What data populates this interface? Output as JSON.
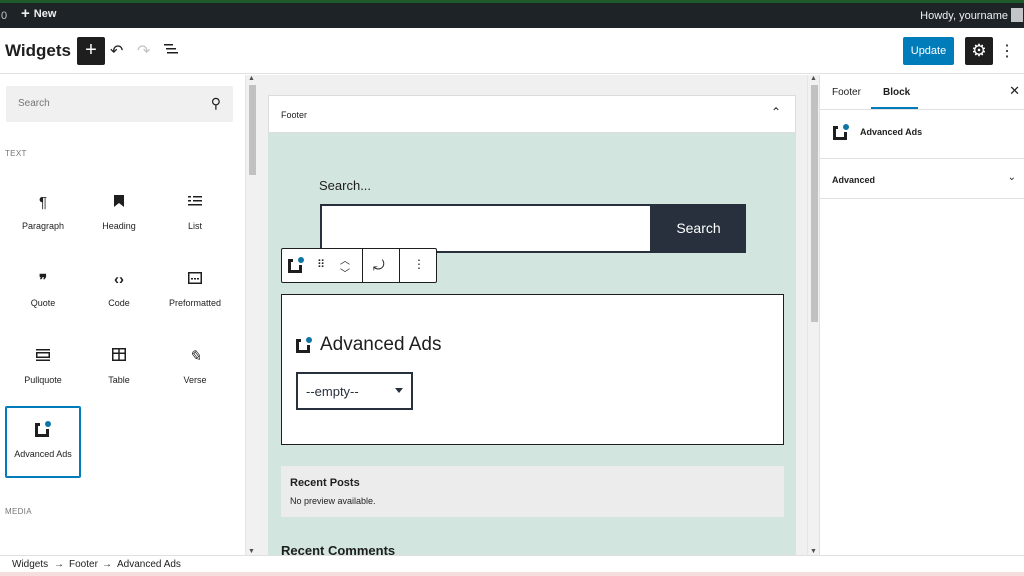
{
  "admin_bar": {
    "count": "0",
    "new_label": "New",
    "howdy": "Howdy, yourname"
  },
  "header": {
    "title": "Widgets",
    "update_label": "Update",
    "icons": [
      "plus-icon",
      "undo-icon",
      "redo-icon",
      "list-view-icon",
      "gear-icon",
      "more-options-icon"
    ]
  },
  "inserter": {
    "search_placeholder": "Search",
    "category_text": "TEXT",
    "category_media": "MEDIA",
    "blocks": [
      {
        "label": "Paragraph",
        "icon": "paragraph-icon",
        "glyph": "¶"
      },
      {
        "label": "Heading",
        "icon": "heading-icon",
        "glyph": "🔖"
      },
      {
        "label": "List",
        "icon": "list-icon",
        "glyph": "☰"
      },
      {
        "label": "Quote",
        "icon": "quote-icon",
        "glyph": "❞"
      },
      {
        "label": "Code",
        "icon": "code-icon",
        "glyph": "‹›"
      },
      {
        "label": "Preformatted",
        "icon": "preformatted-icon",
        "glyph": "▭"
      },
      {
        "label": "Pullquote",
        "icon": "pullquote-icon",
        "glyph": "▭"
      },
      {
        "label": "Table",
        "icon": "table-icon",
        "glyph": "▦"
      },
      {
        "label": "Verse",
        "icon": "verse-icon",
        "glyph": "✎"
      },
      {
        "label": "Advanced Ads",
        "icon": "advanced-ads-icon",
        "selected": true
      }
    ]
  },
  "canvas": {
    "area_title": "Footer",
    "search_label": "Search...",
    "search_button": "Search",
    "ads_block_title": "Advanced Ads",
    "ads_select_value": "--empty--",
    "recent_posts_title": "Recent Posts",
    "recent_posts_sub": "No preview available.",
    "recent_comments_title": "Recent Comments"
  },
  "sidebar": {
    "tabs": [
      {
        "label": "Footer"
      },
      {
        "label": "Block",
        "active": true
      }
    ],
    "block_name": "Advanced Ads",
    "panel_title": "Advanced"
  },
  "breadcrumb": {
    "items": [
      "Widgets",
      "Footer",
      "Advanced Ads"
    ],
    "separator": "→"
  },
  "colors": {
    "accent": "#007cba",
    "dark": "#1e1e1e",
    "footer_bg": "#d2e5de",
    "theme_dark": "#28303d",
    "admin_bar": "#1d2327"
  }
}
